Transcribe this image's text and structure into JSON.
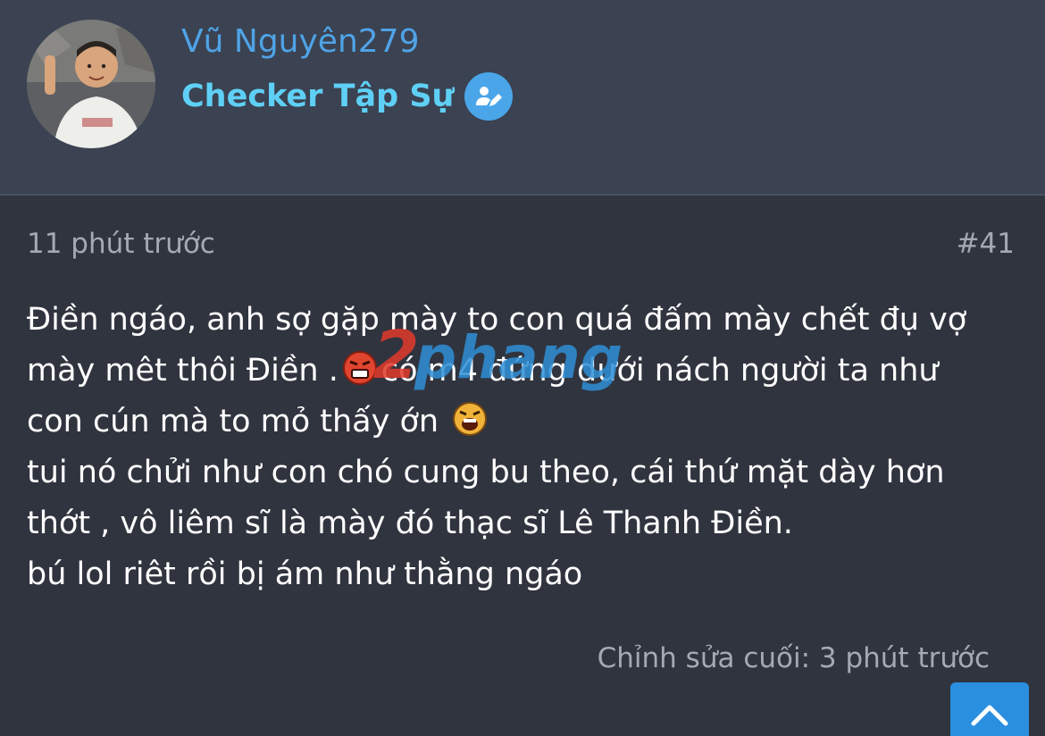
{
  "user": {
    "name": "Vũ Nguyên279",
    "title": "Checker Tập Sự",
    "badge_icon": "pencil-person-icon",
    "accent_name_color": "#4fa3e6",
    "accent_title_color": "#5fd0f5"
  },
  "post": {
    "time": "11 phút trước",
    "number": "#41",
    "lines": {
      "l1": "Điền ngáo, anh sợ gặp mày to con quá đấm mày chết đụ vợ",
      "l2a": "mày mêt thôi Điền .",
      "l2b": "có m4 đứng dưới nách người ta như",
      "l3": "con cún mà to mỏ thấy ớn",
      "l4": "tui nó chửi như con chó cung bu theo, cái thứ mặt dày hơn",
      "l5": "thớt , vô liêm sĩ là mày đó thạc sĩ Lê Thanh Điền.",
      "l6": "bú lol riêt rồi bị ám như thằng ngáo"
    },
    "emojis": [
      "angry-face-icon",
      "shouting-face-icon"
    ],
    "last_edit": "Chỉnh sửa cuối: 3 phút trước"
  },
  "watermark": {
    "text": "2phang"
  },
  "scroll_top_icon": "arrow-up-icon"
}
